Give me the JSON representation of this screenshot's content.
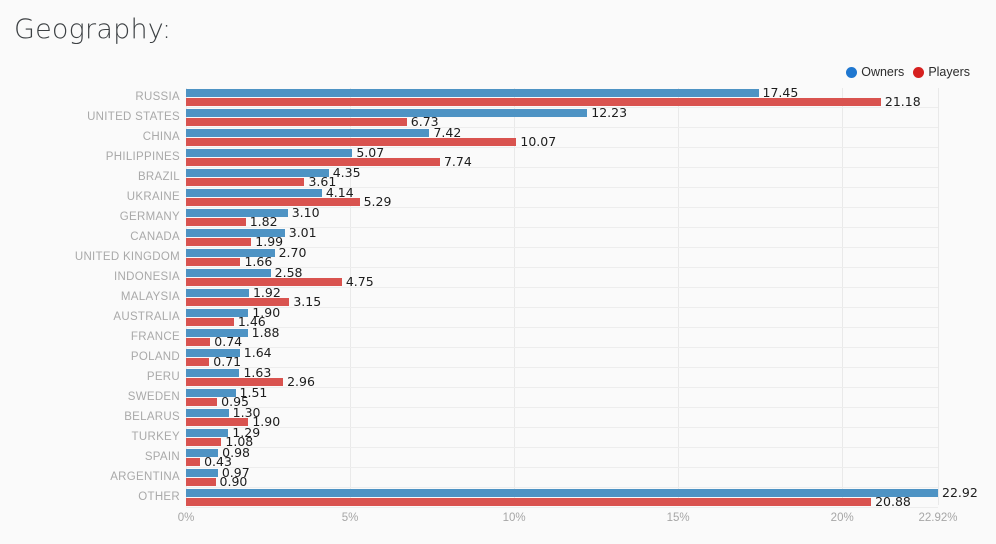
{
  "page": {
    "title": "Geography:",
    "background_color": "#fafafa"
  },
  "legend": {
    "position": "top-right",
    "items": [
      {
        "label": "Owners",
        "color": "#1f77d0",
        "icon": "circle-icon"
      },
      {
        "label": "Players",
        "color": "#d6201f",
        "icon": "circle-icon"
      }
    ]
  },
  "chart_data": {
    "type": "bar",
    "orientation": "horizontal",
    "title": "Geography:",
    "xlabel": "",
    "ylabel": "",
    "xlim": [
      0,
      22.92
    ],
    "grid": true,
    "legend_position": "top-right",
    "value_format": "0.00",
    "tick_labels": [
      "0%",
      "5%",
      "10%",
      "15%",
      "20%",
      "22.92%"
    ],
    "tick_values": [
      0,
      5,
      10,
      15,
      20,
      22.92
    ],
    "categories": [
      "RUSSIA",
      "UNITED STATES",
      "CHINA",
      "PHILIPPINES",
      "BRAZIL",
      "UKRAINE",
      "GERMANY",
      "CANADA",
      "UNITED KINGDOM",
      "INDONESIA",
      "MALAYSIA",
      "AUSTRALIA",
      "FRANCE",
      "POLAND",
      "PERU",
      "SWEDEN",
      "BELARUS",
      "TURKEY",
      "SPAIN",
      "ARGENTINA",
      "OTHER"
    ],
    "series": [
      {
        "name": "Owners",
        "color": "#4e93c4",
        "values": [
          17.45,
          12.23,
          7.42,
          5.07,
          4.35,
          4.14,
          3.1,
          3.01,
          2.7,
          2.58,
          1.92,
          1.9,
          1.88,
          1.64,
          1.63,
          1.51,
          1.3,
          1.29,
          0.98,
          0.97,
          22.92
        ],
        "labels": [
          "17.45",
          "12.23",
          "7.42",
          "5.07",
          "4.35",
          "4.14",
          "3.10",
          "3.01",
          "2.70",
          "2.58",
          "1.92",
          "1.90",
          "1.88",
          "1.64",
          "1.63",
          "1.51",
          "1.30",
          "1.29",
          "0.98",
          "0.97",
          "22.92"
        ]
      },
      {
        "name": "Players",
        "color": "#d9534f",
        "values": [
          21.18,
          6.73,
          10.07,
          7.74,
          3.61,
          5.29,
          1.82,
          1.99,
          1.66,
          4.75,
          3.15,
          1.46,
          0.74,
          0.71,
          2.96,
          0.95,
          1.9,
          1.08,
          0.43,
          0.9,
          20.88
        ],
        "labels": [
          "21.18",
          "6.73",
          "10.07",
          "7.74",
          "3.61",
          "5.29",
          "1.82",
          "1.99",
          "1.66",
          "4.75",
          "3.15",
          "1.46",
          "0.74",
          "0.71",
          "2.96",
          "0.95",
          "1.90",
          "1.08",
          "0.43",
          "0.90",
          "20.88"
        ]
      }
    ]
  }
}
